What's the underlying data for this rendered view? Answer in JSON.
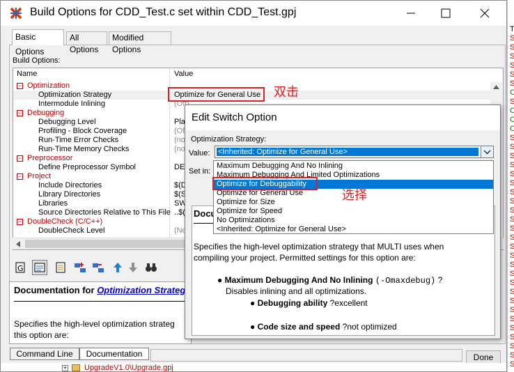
{
  "window": {
    "title": "Build Options for CDD_Test.c set within CDD_Test.gpj"
  },
  "tabs": [
    {
      "label": "Basic Options",
      "active": true
    },
    {
      "label": "All Options",
      "active": false
    },
    {
      "label": "Modified Options",
      "active": false
    }
  ],
  "build_options_label": "Build Options:",
  "columns": {
    "name": "Name",
    "value": "Value"
  },
  "tree_rows": [
    {
      "kind": "cat",
      "label": "Optimization",
      "value": ""
    },
    {
      "kind": "opt",
      "label": "Optimization Strategy",
      "value": "Optimize for General Use",
      "inherited": false
    },
    {
      "kind": "opt",
      "label": "Intermodule Inlining",
      "value": "(Off)",
      "inherited": true
    },
    {
      "kind": "cat",
      "label": "Debugging",
      "value": ""
    },
    {
      "kind": "opt",
      "label": "Debugging Level",
      "value": "Pla",
      "inherited": false
    },
    {
      "kind": "opt",
      "label": "Profiling - Block Coverage",
      "value": "(Off",
      "inherited": true
    },
    {
      "kind": "opt",
      "label": "Run-Time Error Checks",
      "value": "(no",
      "inherited": true
    },
    {
      "kind": "opt",
      "label": "Run-Time Memory Checks",
      "value": "(no",
      "inherited": true
    },
    {
      "kind": "cat",
      "label": "Preprocessor",
      "value": ""
    },
    {
      "kind": "opt",
      "label": "Define Preprocessor Symbol",
      "value": "DE",
      "inherited": false
    },
    {
      "kind": "cat",
      "label": "Project",
      "value": ""
    },
    {
      "kind": "opt",
      "label": "Include Directories",
      "value": "$(D",
      "inherited": false
    },
    {
      "kind": "opt",
      "label": "Library Directories",
      "value": "$(S",
      "inherited": false
    },
    {
      "kind": "opt",
      "label": "Libraries",
      "value": "SW",
      "inherited": false
    },
    {
      "kind": "opt",
      "label": "Source Directories Relative to This File",
      "value": "..$(",
      "inherited": false
    },
    {
      "kind": "cat",
      "label": "DoubleCheck (C/C++)",
      "value": ""
    },
    {
      "kind": "opt",
      "label": "DoubleCheck Level",
      "value": "(No",
      "inherited": true
    }
  ],
  "doc_panel": {
    "heading": "Documentation for",
    "link": "Optimization Strateg",
    "text_line1": "Specifies the high-level optimization strateg",
    "text_line2": "this option are:"
  },
  "bottom_tabs": [
    {
      "label": "Command Line"
    },
    {
      "label": "Documentation"
    }
  ],
  "done_button": "Done",
  "bottom_strip_text": "UpgradeV1.0\\Upgrade.gpj",
  "bottom_strip_box": "+",
  "annotations": {
    "double_click": "双击",
    "select": "选择"
  },
  "dialog": {
    "title": "Edit Switch Option",
    "strategy_label": "Optimization Strategy:",
    "value_label": "Value:",
    "value_selected": "<Inherited: Optimize for General Use>",
    "set_in_label": "Set in:",
    "dropdown_options": [
      "Maximum Debugging And No Inlining",
      "Maximum Debugging And Limited Optimizations",
      "Optimize for Debuggability",
      "Optimize for General Use",
      "Optimize for Size",
      "Optimize for Speed",
      "No Optimizations",
      "<Inherited: Optimize for General Use>"
    ],
    "highlighted_option": "Optimize for Debuggability",
    "doc_heading": "Docu",
    "doc_line1": "Specifies the high-level optimization strategy that MULTI uses when",
    "doc_line2": "compiling your project. Permitted settings for this option are:",
    "bullet1_title": "Maximum Debugging And No Inlining",
    "bullet1_flag": "(-Omaxdebug)",
    "bullet1_q": "?",
    "bullet1_desc": "Disables inlining and all optimizations.",
    "sub1_label": "Debugging ability",
    "sub1_value": "?excellent",
    "sub2_label": "Code size and speed",
    "sub2_value": "?not optimized"
  },
  "right_edge_chars": [
    "T",
    "S",
    "S",
    "S",
    "S",
    "S",
    "S",
    "C",
    "S",
    "C",
    "C",
    "C",
    "S",
    "S",
    "S",
    "S",
    "S",
    "S",
    "S",
    "S",
    "S",
    "S",
    "S",
    "S",
    "S",
    "S",
    "S",
    "S",
    "S",
    "S",
    "S",
    "S",
    "S",
    "S",
    "S",
    "S",
    "S",
    "S"
  ],
  "colors": {
    "accent_red": "#c00000",
    "highlight": "#0078d7",
    "annotation": "#e02020"
  }
}
